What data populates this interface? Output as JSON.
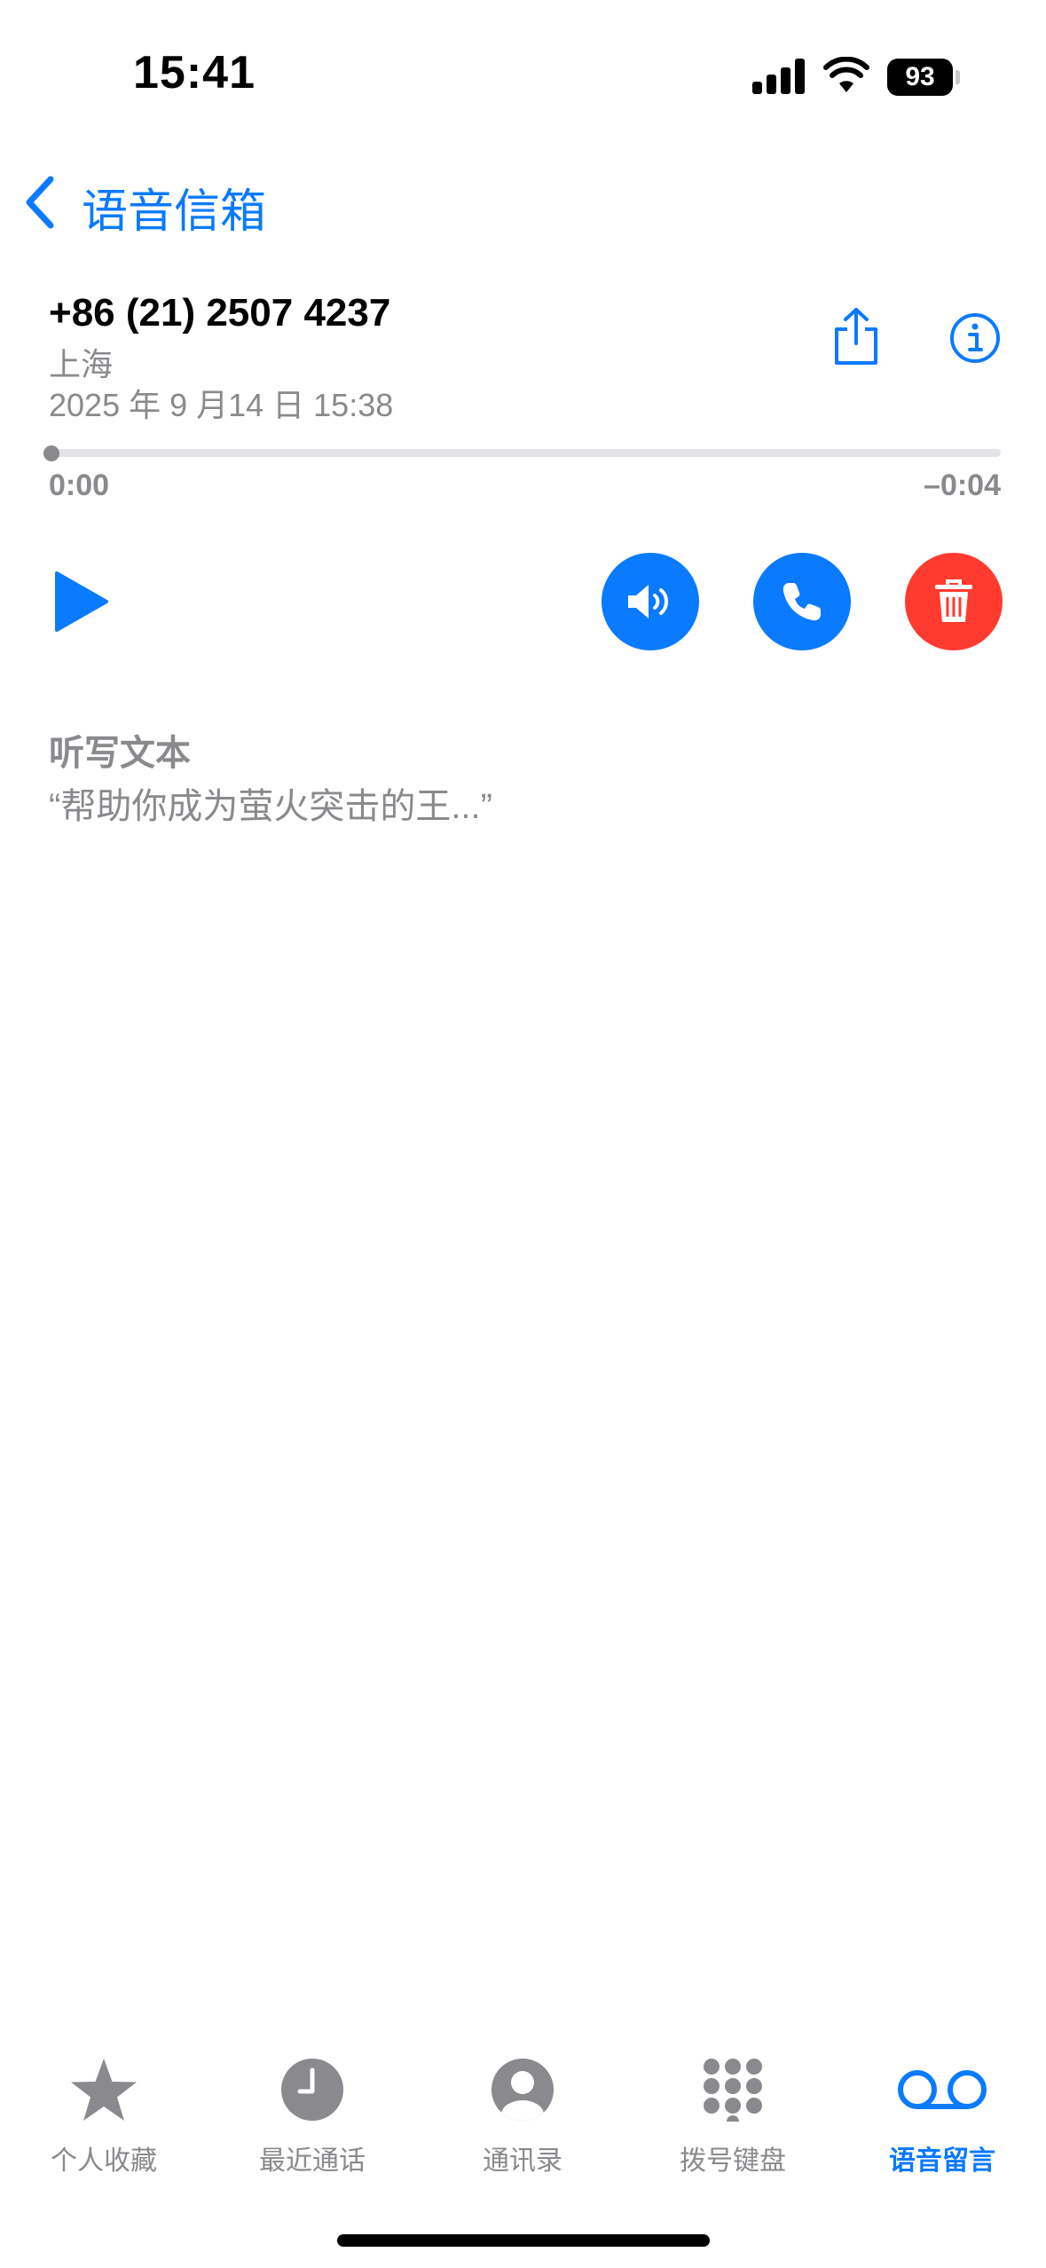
{
  "status_bar": {
    "time": "15:41",
    "battery": "93"
  },
  "nav": {
    "back_label": "语音信箱"
  },
  "voicemail": {
    "phone_number": "+86 (21) 2507 4237",
    "location": "上海",
    "datetime": "2025 年 9 月14 日 15:38",
    "elapsed": "0:00",
    "remaining": "–0:04",
    "progress": 0.0
  },
  "transcript": {
    "title": "听写文本",
    "text": "“帮助你成为萤火突击的王...”"
  },
  "tabs": [
    {
      "label": "个人收藏",
      "icon": "star-icon"
    },
    {
      "label": "最近通话",
      "icon": "clock-icon"
    },
    {
      "label": "通讯录",
      "icon": "contact-icon"
    },
    {
      "label": "拨号键盘",
      "icon": "keypad-icon"
    },
    {
      "label": "语音留言",
      "icon": "voicemail-icon",
      "active": true
    }
  ],
  "colors": {
    "accent": "#0a7aff",
    "destructive": "#ff3b30",
    "secondary_text": "#8a8a8e"
  }
}
